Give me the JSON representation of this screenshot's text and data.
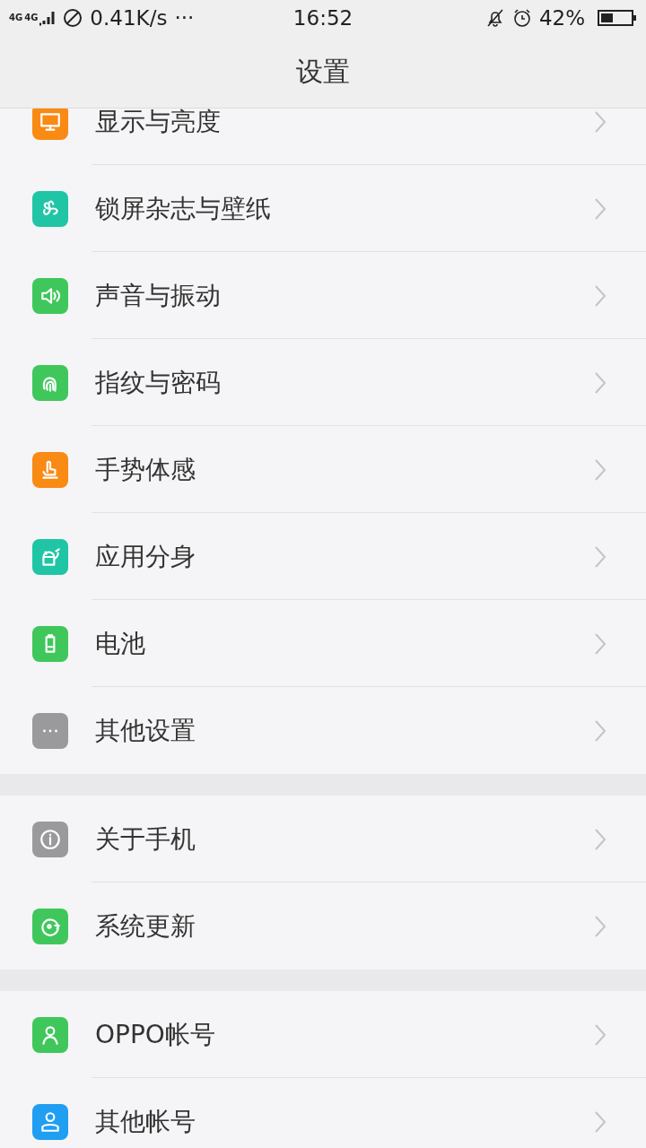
{
  "status_bar": {
    "network_1": "4G",
    "network_2": "4G",
    "speed": "0.41K/s",
    "more": "···",
    "time": "16:52",
    "battery_text": "42%"
  },
  "header": {
    "title": "设置"
  },
  "sections": [
    {
      "items": [
        {
          "label": "显示与亮度",
          "color": "#f98a14"
        },
        {
          "label": "锁屏杂志与壁纸",
          "color": "#1fc5a4"
        },
        {
          "label": "声音与振动",
          "color": "#3fc75c"
        },
        {
          "label": "指纹与密码",
          "color": "#3fc75c"
        },
        {
          "label": "手势体感",
          "color": "#f98a14"
        },
        {
          "label": "应用分身",
          "color": "#1fc5a4"
        },
        {
          "label": "电池",
          "color": "#3fc75c"
        },
        {
          "label": "其他设置",
          "color": "#9a9a9c"
        }
      ]
    },
    {
      "items": [
        {
          "label": "关于手机",
          "color": "#9a9a9c"
        },
        {
          "label": "系统更新",
          "color": "#3fc75c"
        }
      ]
    },
    {
      "items": [
        {
          "label": "OPPO帐号",
          "color": "#3fc75c"
        },
        {
          "label": "其他帐号",
          "color": "#1f9ef2"
        }
      ]
    }
  ]
}
